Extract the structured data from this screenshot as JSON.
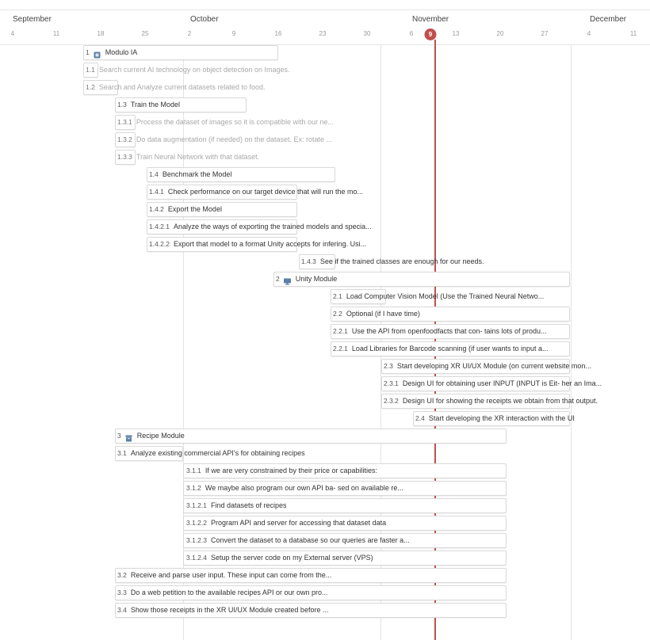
{
  "timeline": {
    "months": [
      {
        "label": "September"
      },
      {
        "label": "October"
      },
      {
        "label": "November"
      },
      {
        "label": "December"
      }
    ],
    "days": [
      "4",
      "11",
      "18",
      "25",
      "2",
      "9",
      "16",
      "23",
      "30",
      "6",
      "13",
      "20",
      "27",
      "4",
      "11"
    ],
    "today": "9"
  },
  "tasks": [
    {
      "num": "1",
      "label": "Modulo IA",
      "icon": "module-icon",
      "style": "dark"
    },
    {
      "num": "1.1",
      "label": "Search current AI technology on object detection on Images.",
      "style": "light"
    },
    {
      "num": "1.2",
      "label": "Search and Analyze current datasets related to food.",
      "style": "light"
    },
    {
      "num": "1.3",
      "label": "Train the Model",
      "style": "dark"
    },
    {
      "num": "1.3.1",
      "label": "Process the dataset of images so it is compatible with our ne...",
      "style": "light"
    },
    {
      "num": "1.3.2",
      "label": "Do data augmentation (if needed) on the dataset. Ex: rotate ...",
      "style": "light"
    },
    {
      "num": "1.3.3",
      "label": "Train Neural Network with that dataset.",
      "style": "light"
    },
    {
      "num": "1.4",
      "label": "Benchmark the Model",
      "style": "dark"
    },
    {
      "num": "1.4.1",
      "label": "Check performance on our target device that will run the mo...",
      "style": "dark"
    },
    {
      "num": "1.4.2",
      "label": "Export the Model",
      "style": "dark"
    },
    {
      "num": "1.4.2.1",
      "label": "Analyze the ways of exporting the trained models and specia...",
      "style": "dark"
    },
    {
      "num": "1.4.2.2",
      "label": "Export that model to a format Unity accepts for infering. Usi...",
      "style": "dark"
    },
    {
      "num": "1.4.3",
      "label": "See if the trained classes are enough for our needs.",
      "style": "dark"
    },
    {
      "num": "2",
      "label": "Unity Module",
      "icon": "monitor-icon",
      "style": "dark"
    },
    {
      "num": "2.1",
      "label": "Load Computer Vision Model (Use the Trained Neural Netwo...",
      "style": "dark"
    },
    {
      "num": "2.2",
      "label": "Optional (if I have time)",
      "style": "dark"
    },
    {
      "num": "2.2.1",
      "label": "Use the API from openfoodfacts that con- tains lots of produ...",
      "style": "dark"
    },
    {
      "num": "2.2.1",
      "label": "Load Libraries for Barcode scanning (if user wants to input a...",
      "style": "dark"
    },
    {
      "num": "2.3",
      "label": "Start developing XR UI/UX Module (on current website mon...",
      "style": "dark"
    },
    {
      "num": "2.3.1",
      "label": "Design UI for obtaining user INPUT (INPUT is Eit- her an Ima...",
      "style": "dark"
    },
    {
      "num": "2.3.2",
      "label": "Design UI for showing the receipts we obtain from that output.",
      "style": "dark"
    },
    {
      "num": "2.4",
      "label": "Start developing the XR interaction with the UI",
      "style": "dark"
    },
    {
      "num": "3",
      "label": "Recipe Module",
      "icon": "archive-icon",
      "style": "dark"
    },
    {
      "num": "3.1",
      "label": "Analyze existing commercial API's for obtaining recipes",
      "style": "dark"
    },
    {
      "num": "3.1.1",
      "label": "If we are very constrained by their price or capabilities:",
      "style": "dark"
    },
    {
      "num": "3.1.2",
      "label": "We maybe also program our own API ba- sed on available re...",
      "style": "dark"
    },
    {
      "num": "3.1.2.1",
      "label": "Find datasets of recipes",
      "style": "dark"
    },
    {
      "num": "3.1.2.2",
      "label": "Program API and server for accessing that dataset data",
      "style": "dark"
    },
    {
      "num": "3.1.2.3",
      "label": "Convert the dataset to a database so our queries are faster a...",
      "style": "dark"
    },
    {
      "num": "3.1.2.4",
      "label": "Setup the server code on my External server (VPS)",
      "style": "dark"
    },
    {
      "num": "3.2",
      "label": "Receive and parse user input. These input can come from the...",
      "style": "dark"
    },
    {
      "num": "3.3",
      "label": "Do a web petition to the available recipes API or our own pro...",
      "style": "dark"
    },
    {
      "num": "3.4",
      "label": "Show those receipts in the XR UI/UX Module created before ...",
      "style": "dark"
    }
  ],
  "colors": {
    "today": "#c0504d",
    "gridline": "#e4e4e4",
    "icon": "#5b7fa6"
  }
}
